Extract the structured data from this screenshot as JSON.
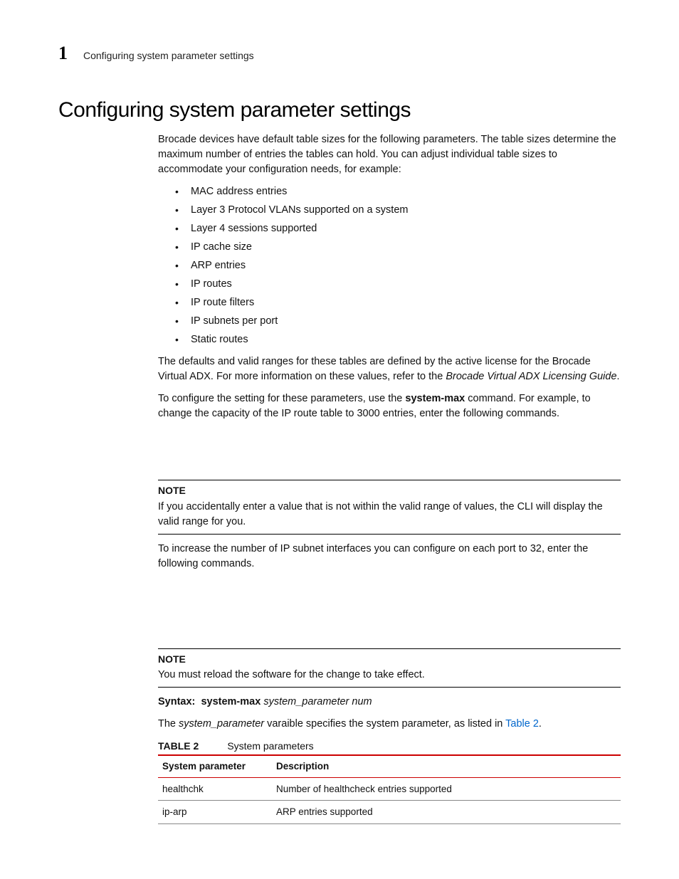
{
  "header": {
    "chapter_number": "1",
    "chapter_title": "Configuring system parameter settings"
  },
  "title": "Configuring system parameter settings",
  "intro_para": "Brocade devices have default table sizes for the following parameters. The table sizes determine the maximum number of entries the tables can hold. You can adjust individual table sizes to accommodate your configuration needs, for example:",
  "bullets": [
    "MAC address entries",
    "Layer 3 Protocol VLANs supported on a system",
    "Layer 4 sessions supported",
    "IP cache size",
    "ARP entries",
    "IP routes",
    "IP route filters",
    "IP subnets per port",
    "Static routes"
  ],
  "defaults_para_pre": "The defaults and valid ranges for these tables are defined by the active license for the Brocade Virtual ADX. For more information on these values, refer to the ",
  "defaults_para_italic": "Brocade Virtual ADX Licensing Guide",
  "defaults_para_post": ".",
  "config_para_pre": "To configure the setting for these parameters, use the ",
  "config_para_bold": "system-max",
  "config_para_post": " command. For example, to change the capacity of the IP route table to 3000 entries, enter the following commands.",
  "note1": {
    "label": "NOTE",
    "text": "If you accidentally enter a value that is not within the valid range of values, the CLI will display the valid range for you."
  },
  "subnet_para": "To increase the number of IP subnet interfaces you can configure on each port to 32, enter the following commands.",
  "note2": {
    "label": "NOTE",
    "text": "You must reload the software for the change to take effect."
  },
  "syntax": {
    "label": "Syntax:",
    "cmd": "system-max",
    "args": "system_parameter num"
  },
  "syntax_desc_pre": "The ",
  "syntax_desc_italic": "system_parameter",
  "syntax_desc_mid": " varaible specifies the system parameter, as listed in ",
  "syntax_desc_link": "Table 2",
  "syntax_desc_post": ".",
  "table": {
    "label": "TABLE 2",
    "caption": "System parameters",
    "headers": {
      "col1": "System parameter",
      "col2": "Description"
    },
    "rows": [
      {
        "param": "healthchk",
        "desc": "Number of healthcheck entries supported"
      },
      {
        "param": "ip-arp",
        "desc": "ARP entries supported"
      }
    ]
  }
}
